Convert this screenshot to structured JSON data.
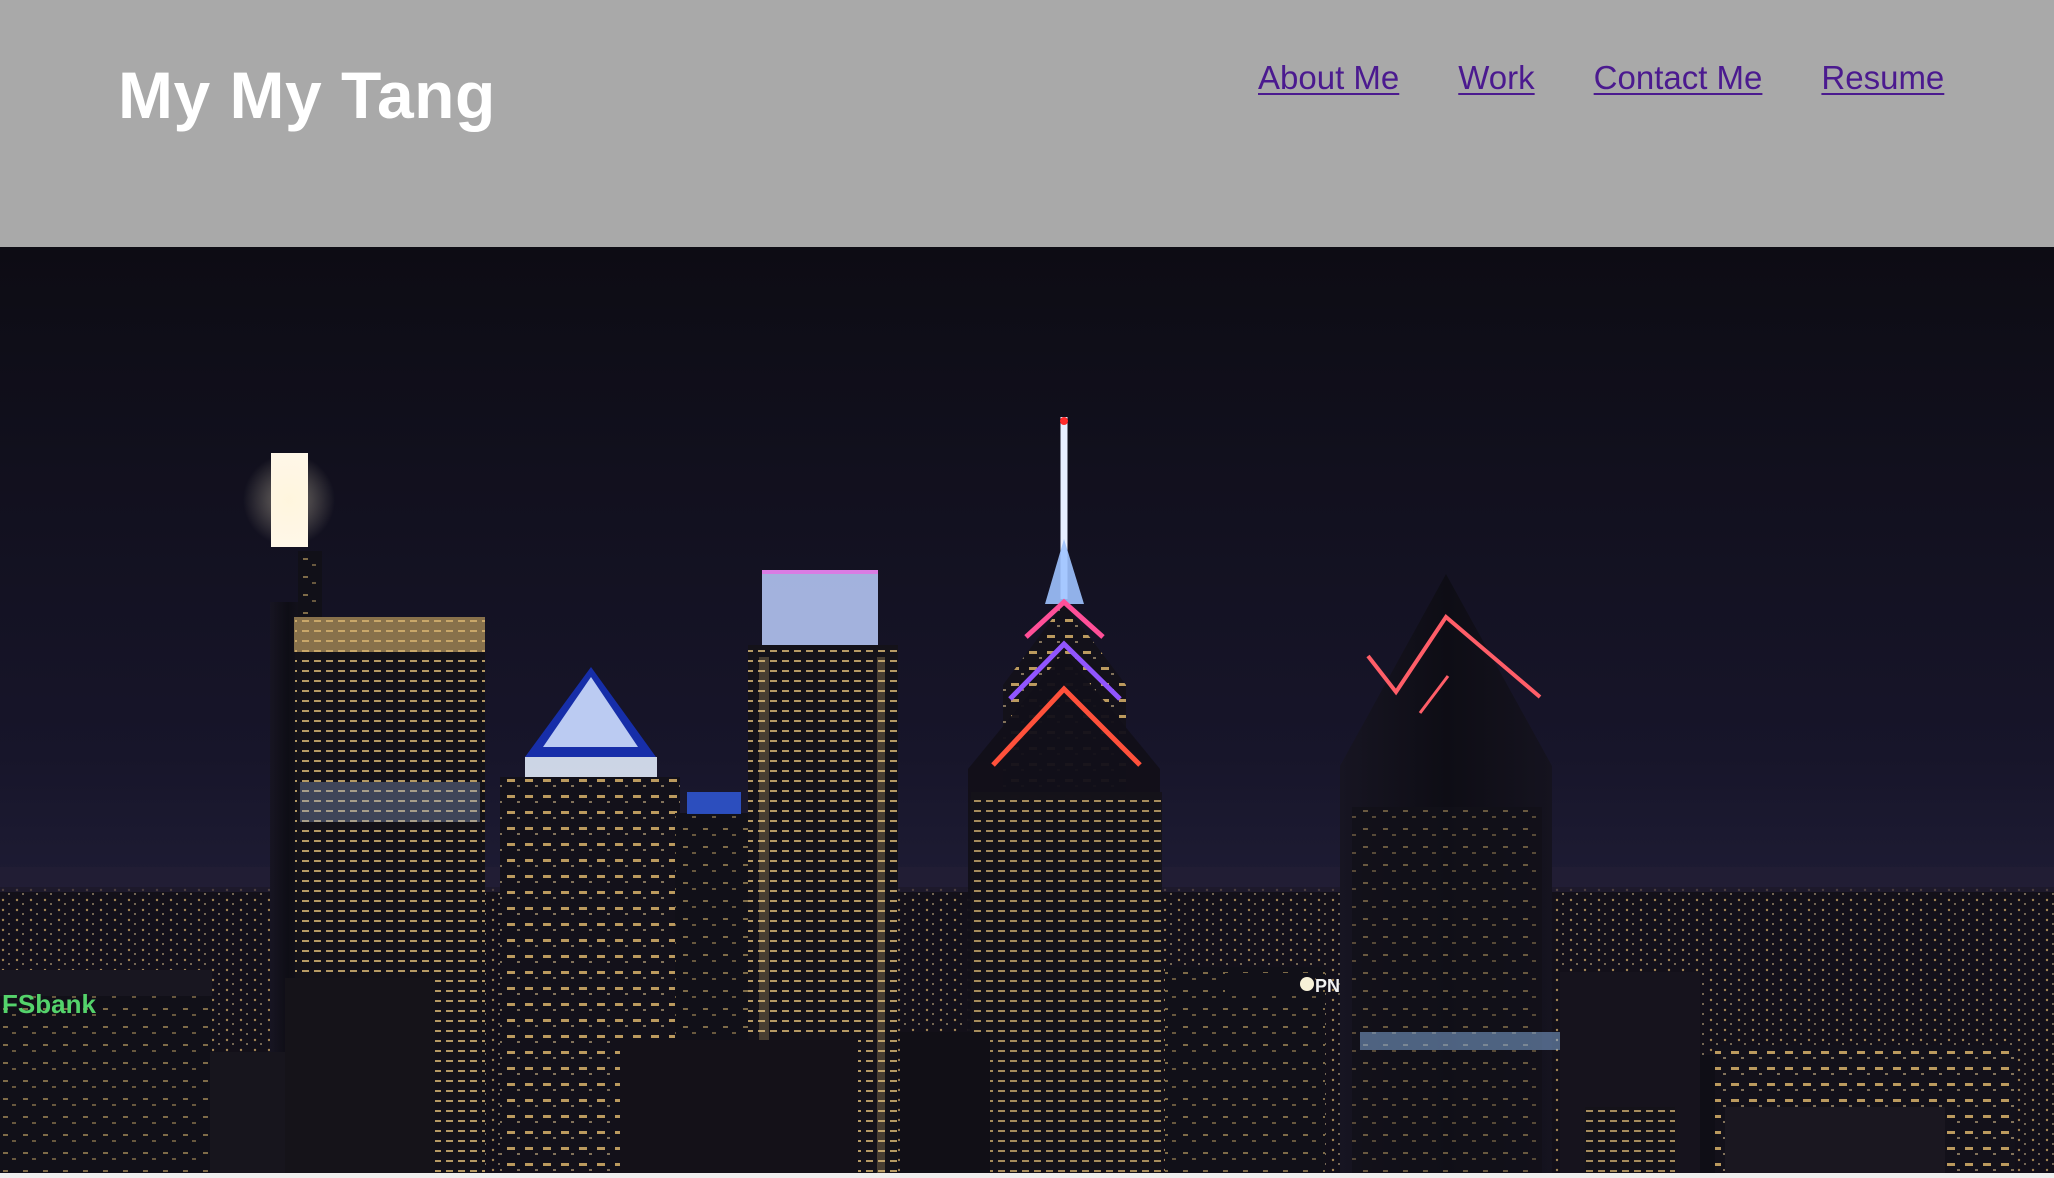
{
  "header": {
    "title": "My My Tang",
    "background": "#a9a9a9",
    "title_color": "#ffffff"
  },
  "nav": {
    "link_color": "#4b1a8f",
    "items": [
      {
        "label": "About Me"
      },
      {
        "label": "Work"
      },
      {
        "label": "Contact Me"
      },
      {
        "label": "Resume"
      }
    ]
  },
  "hero": {
    "image_name": "city-skyline-night-photo",
    "sign_text": "FSbank",
    "small_sign_text": "PN"
  }
}
